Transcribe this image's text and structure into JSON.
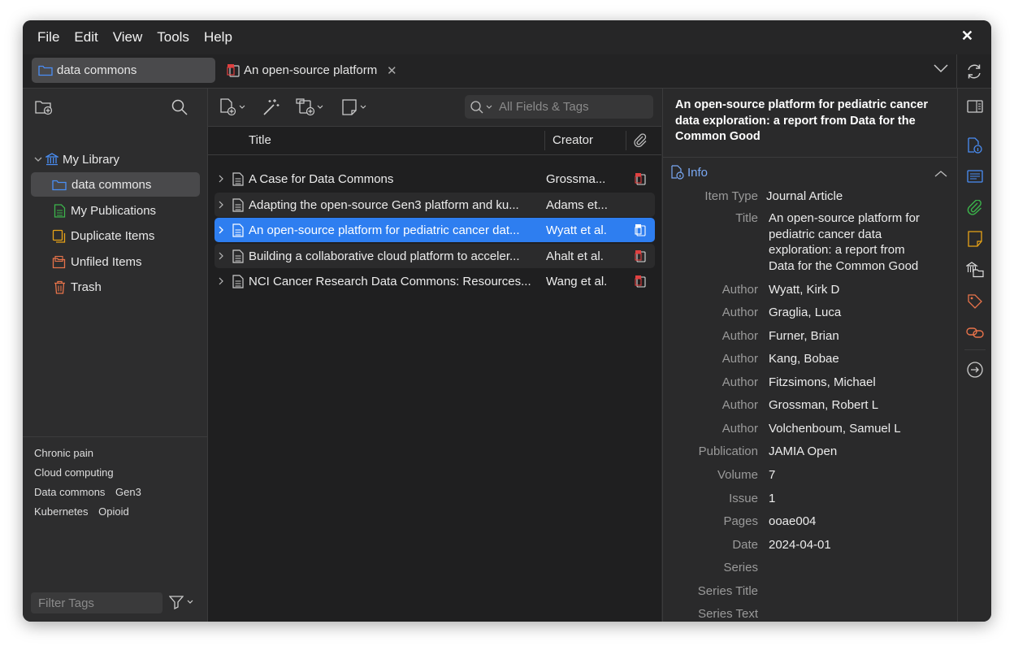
{
  "menu": [
    "File",
    "Edit",
    "View",
    "Tools",
    "Help"
  ],
  "tabs": [
    {
      "label": "data commons",
      "icon": "folder-icon"
    },
    {
      "label": "An open-source platform",
      "icon": "pdf-icon"
    }
  ],
  "sidebar": {
    "library": "My Library",
    "items": [
      {
        "label": "data commons",
        "icon": "folder-icon",
        "color": "#4a8ef5"
      },
      {
        "label": "My Publications",
        "icon": "publications-icon",
        "color": "#3cb44b"
      },
      {
        "label": "Duplicate Items",
        "icon": "duplicate-icon",
        "color": "#e8a317"
      },
      {
        "label": "Unfiled Items",
        "icon": "unfiled-icon",
        "color": "#e8734a"
      },
      {
        "label": "Trash",
        "icon": "trash-icon",
        "color": "#e8734a"
      }
    ],
    "tags": [
      [
        "Chronic pain"
      ],
      [
        "Cloud computing"
      ],
      [
        "Data commons",
        "Gen3"
      ],
      [
        "Kubernetes",
        "Opioid"
      ]
    ],
    "filter_placeholder": "Filter Tags"
  },
  "items_list": {
    "search_placeholder": "All Fields & Tags",
    "columns": {
      "title": "Title",
      "creator": "Creator"
    },
    "rows": [
      {
        "title": "A Case for Data Commons",
        "creator": "Grossma...",
        "attachment": "pdf"
      },
      {
        "title": "Adapting the open-source Gen3 platform and ku...",
        "creator": "Adams et...",
        "attachment": "none"
      },
      {
        "title": "An open-source platform for pediatric cancer dat...",
        "creator": "Wyatt et al.",
        "attachment": "pdf"
      },
      {
        "title": "Building a collaborative cloud platform to acceler...",
        "creator": "Ahalt et al.",
        "attachment": "pdf"
      },
      {
        "title": "NCI Cancer Research Data Commons: Resources...",
        "creator": "Wang et al.",
        "attachment": "pdf"
      }
    ]
  },
  "item_pane": {
    "title": "An open-source platform for pediatric cancer data exploration: a report from Data for the Common Good",
    "section_label": "Info",
    "fields": [
      {
        "label": "Item Type",
        "value": "Journal Article"
      },
      {
        "label": "Title",
        "value": "An open-source platform for pediatric cancer data exploration: a report from Data for the Common Good"
      },
      {
        "label": "Author",
        "value": "Wyatt, Kirk D"
      },
      {
        "label": "Author",
        "value": "Graglia, Luca"
      },
      {
        "label": "Author",
        "value": "Furner, Brian"
      },
      {
        "label": "Author",
        "value": "Kang, Bobae"
      },
      {
        "label": "Author",
        "value": "Fitzsimons, Michael"
      },
      {
        "label": "Author",
        "value": "Grossman, Robert L"
      },
      {
        "label": "Author",
        "value": "Volchenboum, Samuel L"
      },
      {
        "label": "Publication",
        "value": "JAMIA Open"
      },
      {
        "label": "Volume",
        "value": "7"
      },
      {
        "label": "Issue",
        "value": "1"
      },
      {
        "label": "Pages",
        "value": "ooae004"
      },
      {
        "label": "Date",
        "value": "2024-04-01"
      },
      {
        "label": "Series",
        "value": ""
      },
      {
        "label": "Series Title",
        "value": ""
      },
      {
        "label": "Series Text",
        "value": ""
      }
    ]
  },
  "colors": {
    "accent": "#2e7ef0",
    "pdf": "#e04040",
    "info": "#7aa9f5"
  }
}
